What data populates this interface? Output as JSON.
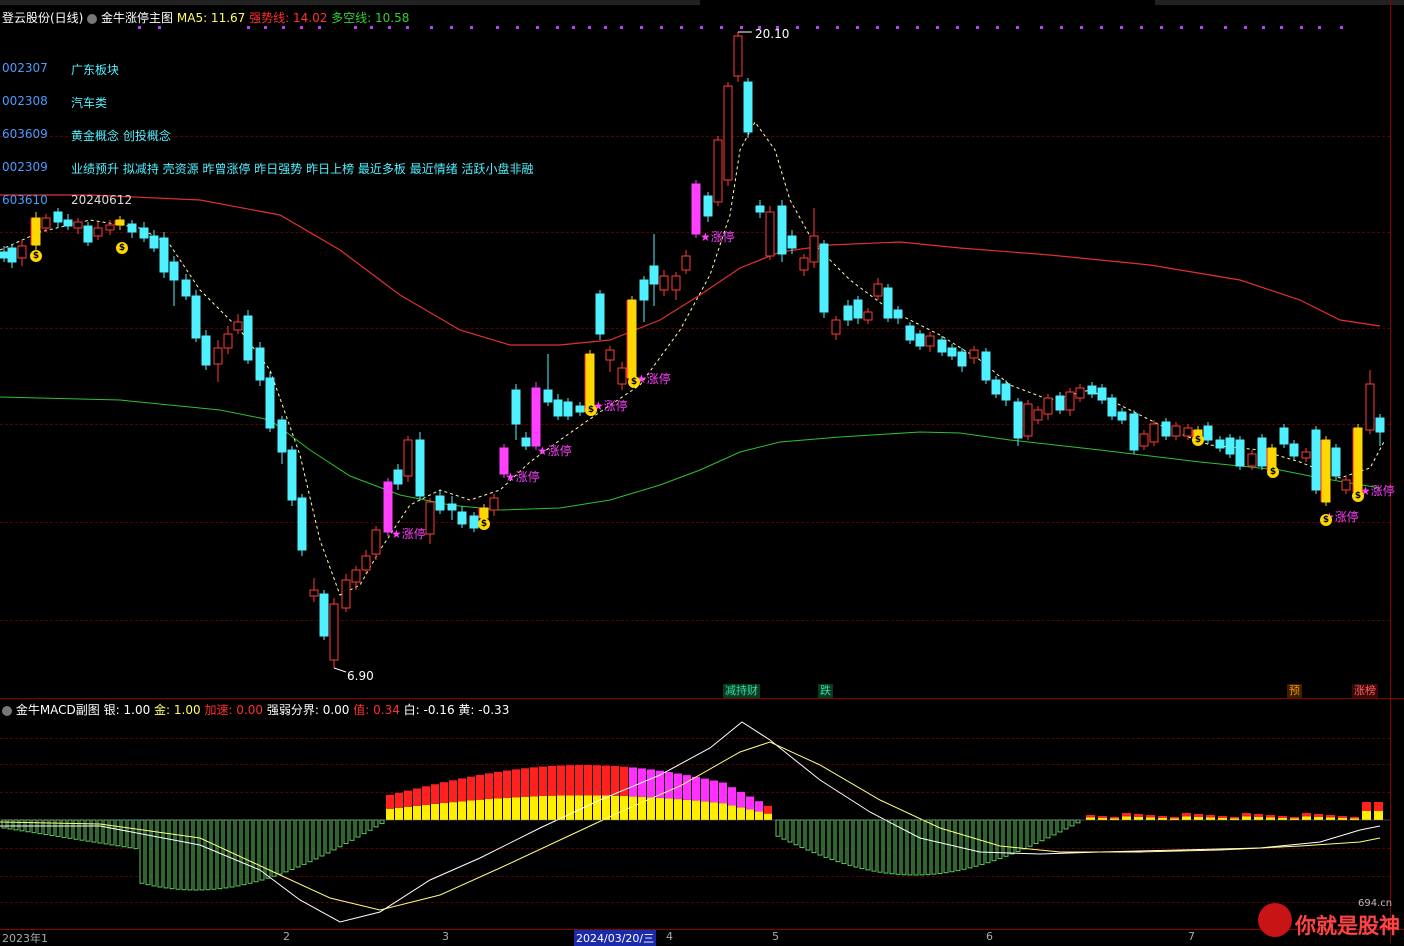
{
  "header": {
    "title": "登云股份(日线)",
    "indicator_name": "金牛涨停主图",
    "ma5_label": "MA5: 11.67",
    "strong_label": "强势线: 14.02",
    "longshort_label": "多空线: 10.58"
  },
  "stock_list": [
    {
      "code": "002307",
      "text": "广东板块"
    },
    {
      "code": "002308",
      "text": "汽车类"
    },
    {
      "code": "603609",
      "text": "黄金概念 创投概念"
    },
    {
      "code": "002309",
      "text": "业绩预升 拟减持 壳资源 昨曾涨停 昨日强势 昨日上榜 最近多板 最近情绪 活跃小盘非融"
    },
    {
      "code": "603610",
      "text": "20240612"
    }
  ],
  "price_labels": {
    "high": "20.10",
    "low": "6.90"
  },
  "limit_up_label": "涨停",
  "coin_label": "$",
  "event_tags": [
    {
      "text": "减持财",
      "color": "#2fe0a0"
    },
    {
      "text": "跌",
      "color": "#2fe0a0"
    },
    {
      "text": "预",
      "color": "#ff8c00"
    },
    {
      "text": "涨榜",
      "color": "#ff4040"
    }
  ],
  "sub_header": {
    "name": "金牛MACD副图",
    "silver": "银: 1.00",
    "gold": "金: 1.00",
    "accel": "加速: 0.00",
    "boundary": "强弱分界: 0.00",
    "value": "值: 0.34",
    "white": "白: -0.16",
    "yellow": "黄: -0.33"
  },
  "time_axis": {
    "labels": [
      "2023年1",
      "2",
      "3",
      "4",
      "5",
      "6",
      "7"
    ],
    "cursor_date": "2024/03/20/三"
  },
  "watermark": {
    "main": "你就是股神",
    "site": "694.cn"
  },
  "colors": {
    "up": "#ff3b3b",
    "down": "#4ff0ff",
    "limit": "#ff40ff",
    "gold": "#ffd700",
    "ma_strong": "#e03030",
    "ma_longshort": "#30c030",
    "ma5": "#ffffb0"
  },
  "chart_data": {
    "type": "candlestick",
    "title": "金牛涨停主图",
    "price_extremes": {
      "high": 20.1,
      "low": 6.9
    },
    "indicators": {
      "MA5": 11.67,
      "强势线": 14.02,
      "多空线": 10.58
    },
    "macd": {
      "银": 1.0,
      "金": 1.0,
      "加速": 0.0,
      "强弱分界": 0.0,
      "值": 0.34,
      "白": -0.16,
      "黄": -0.33
    },
    "x_axis_months": [
      "2023年1",
      "2",
      "3",
      "4",
      "5",
      "6",
      "7"
    ]
  }
}
